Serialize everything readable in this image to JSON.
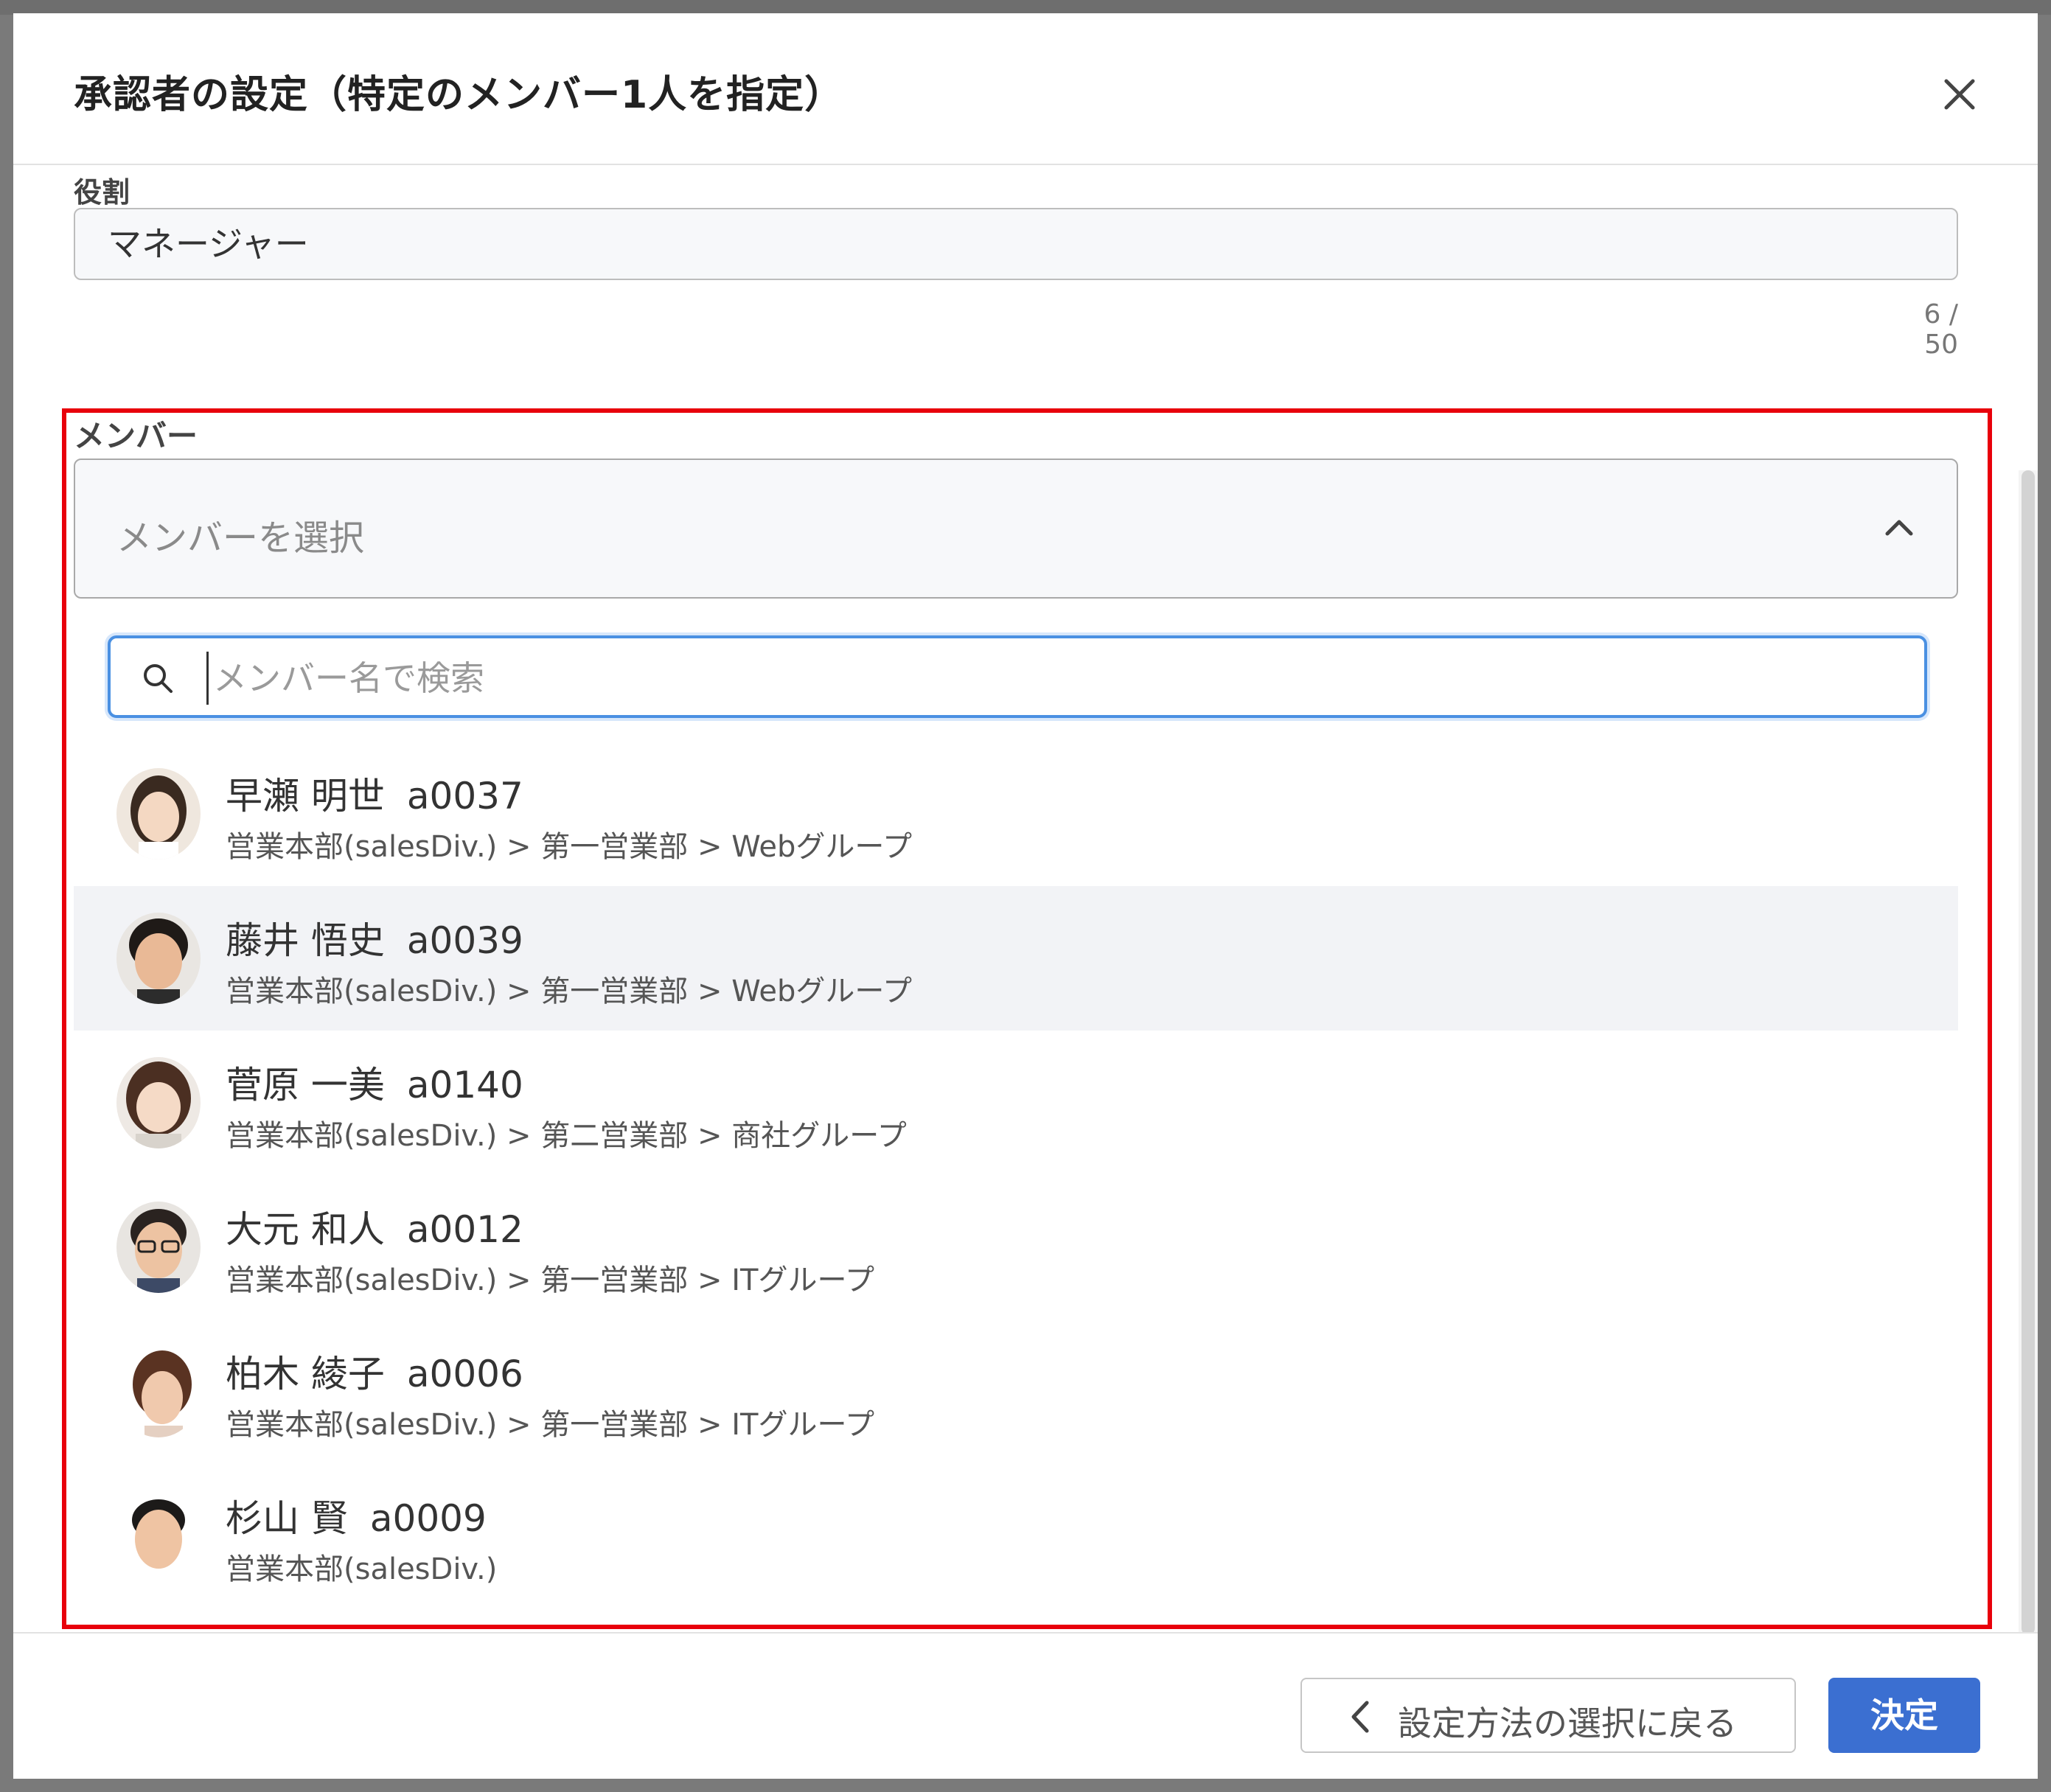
{
  "dialog": {
    "title": "承認者の設定（特定のメンバー1人を指定）",
    "close_icon": "close-icon"
  },
  "role": {
    "label": "役割",
    "value": "マネージャー",
    "counter": "6 / 50"
  },
  "member": {
    "label": "メンバー",
    "placeholder": "メンバーを選択",
    "chevron_icon": "chevron-up-icon",
    "search_placeholder": "メンバー名で検索",
    "items": [
      {
        "name": "早瀬 明世",
        "id": "a0037",
        "path": "営業本部(salesDiv.) > 第一営業部 > Webグループ"
      },
      {
        "name": "藤井 悟史",
        "id": "a0039",
        "path": "営業本部(salesDiv.) > 第一営業部 > Webグループ"
      },
      {
        "name": "菅原 一美",
        "id": "a0140",
        "path": "営業本部(salesDiv.) > 第二営業部 > 商社グループ"
      },
      {
        "name": "大元 和人",
        "id": "a0012",
        "path": "営業本部(salesDiv.) > 第一営業部 > ITグループ"
      },
      {
        "name": "柏木 綾子",
        "id": "a0006",
        "path": "営業本部(salesDiv.) > 第一営業部 > ITグループ"
      },
      {
        "name": "杉山 賢",
        "id": "a0009",
        "path": "営業本部(salesDiv.)"
      }
    ]
  },
  "footer": {
    "back_label": "設定方法の選択に戻る",
    "ok_label": "決定"
  },
  "colors": {
    "accent": "#3b6fd1",
    "focus": "#4a90e2",
    "highlight": "#e8000b"
  }
}
